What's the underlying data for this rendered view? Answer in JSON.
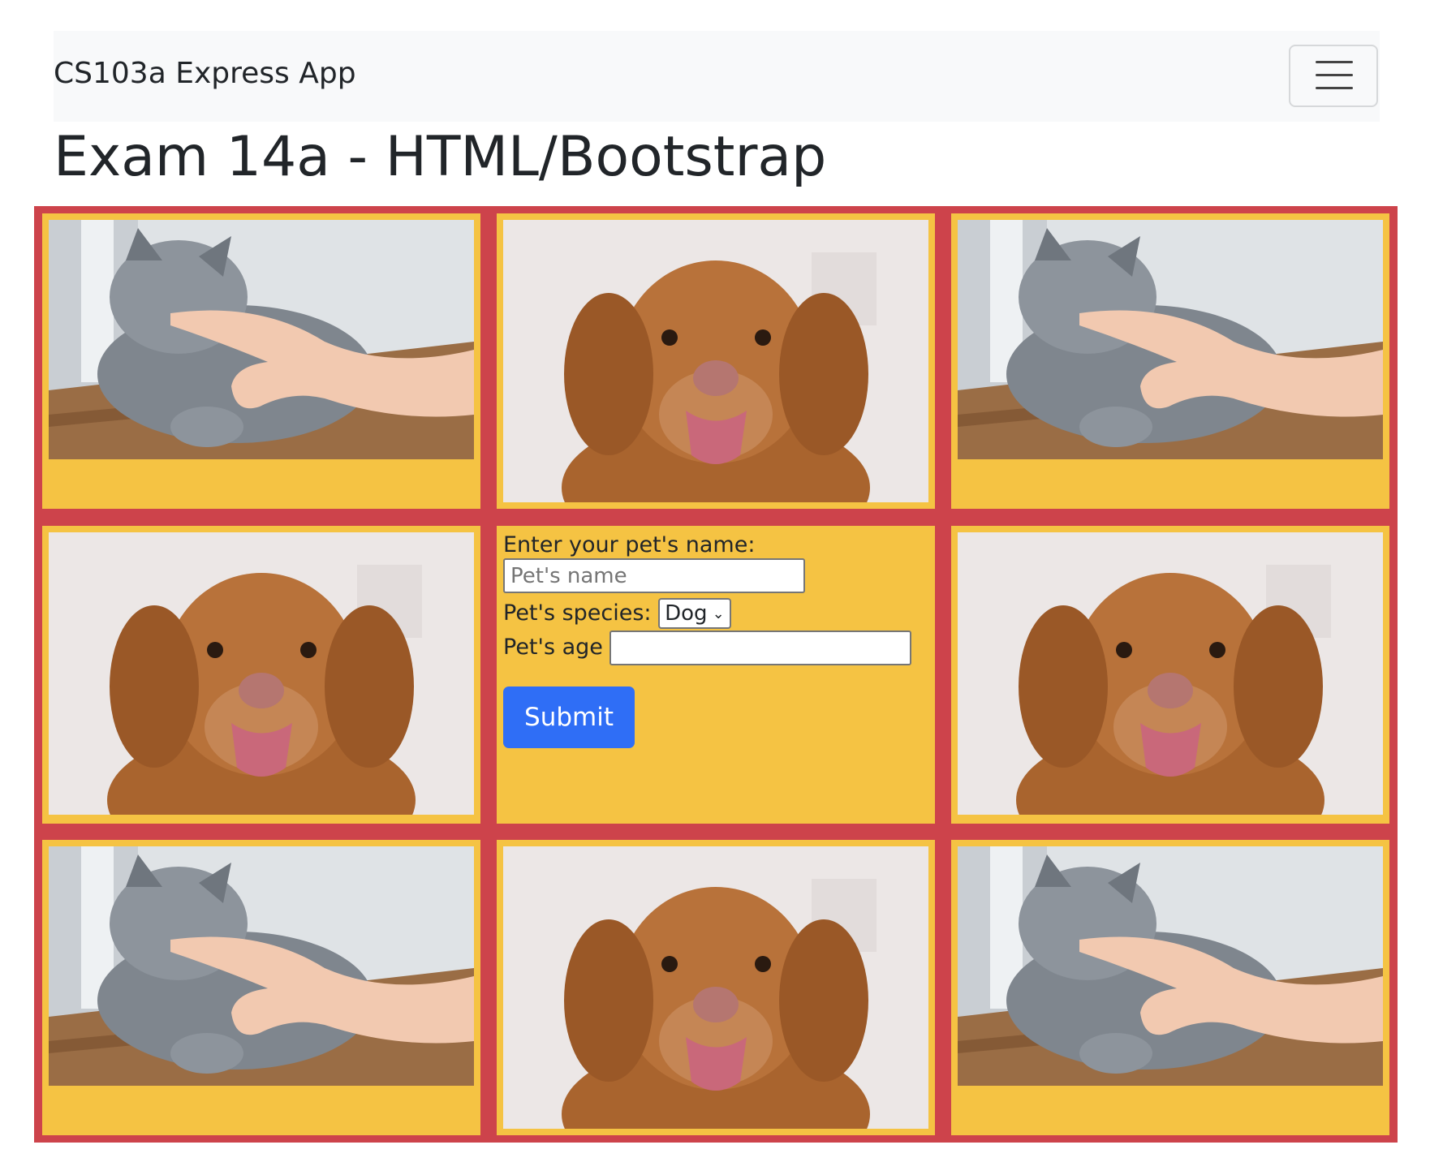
{
  "navbar": {
    "brand": "CS103a Express App"
  },
  "page": {
    "title": "Exam 14a - HTML/Bootstrap"
  },
  "grid": {
    "cells": [
      {
        "photo": "cat"
      },
      {
        "photo": "dog"
      },
      {
        "photo": "cat"
      },
      {
        "photo": "dog"
      },
      {
        "form": true
      },
      {
        "photo": "dog"
      },
      {
        "photo": "cat"
      },
      {
        "photo": "dog"
      },
      {
        "photo": "cat"
      }
    ]
  },
  "form": {
    "name_label": "Enter your pet's name:",
    "name_placeholder": "Pet's name",
    "name_value": "",
    "species_label": "Pet's species:",
    "species_selected": "Dog",
    "age_label": "Pet's age",
    "age_value": "",
    "submit_label": "Submit"
  },
  "colors": {
    "grid_border": "#cd434b",
    "cell_background": "#f5c343",
    "submit_button": "#2f6ef6",
    "navbar_background": "#f8f9fa"
  },
  "icons": {
    "toggler": "hamburger-icon",
    "select_caret": "chevron-down-icon"
  }
}
